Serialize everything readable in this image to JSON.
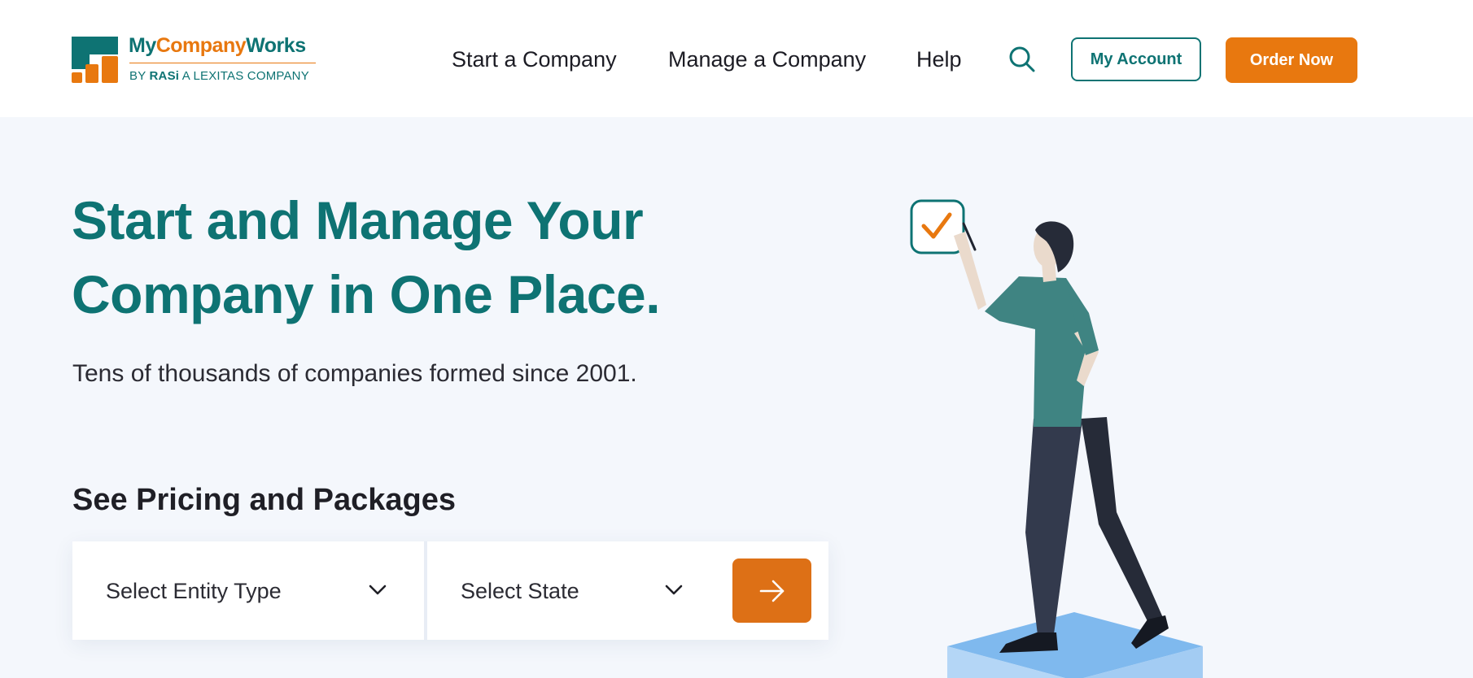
{
  "header": {
    "logo": {
      "name_part1": "My",
      "name_part2": "Company",
      "name_part3": "Works",
      "tagline_prefix": "BY",
      "tagline_brand": "RASi",
      "tagline_suffix": "A LEXITAS COMPANY"
    },
    "nav": {
      "start": "Start a Company",
      "manage": "Manage a Company",
      "help": "Help"
    },
    "search_icon": "search-icon",
    "my_account": "My Account",
    "order_now": "Order Now"
  },
  "hero": {
    "title_line1": "Start and Manage Your",
    "title_line2": "Company in One Place.",
    "subtitle": "Tens of thousands of companies formed since 2001."
  },
  "pricing": {
    "title": "See Pricing and Packages",
    "entity_select": "Select Entity Type",
    "state_select": "Select State",
    "go_icon": "arrow-right-icon"
  },
  "colors": {
    "brand_teal": "#0e7373",
    "brand_orange": "#e8780f",
    "background": "#f4f7fc"
  }
}
